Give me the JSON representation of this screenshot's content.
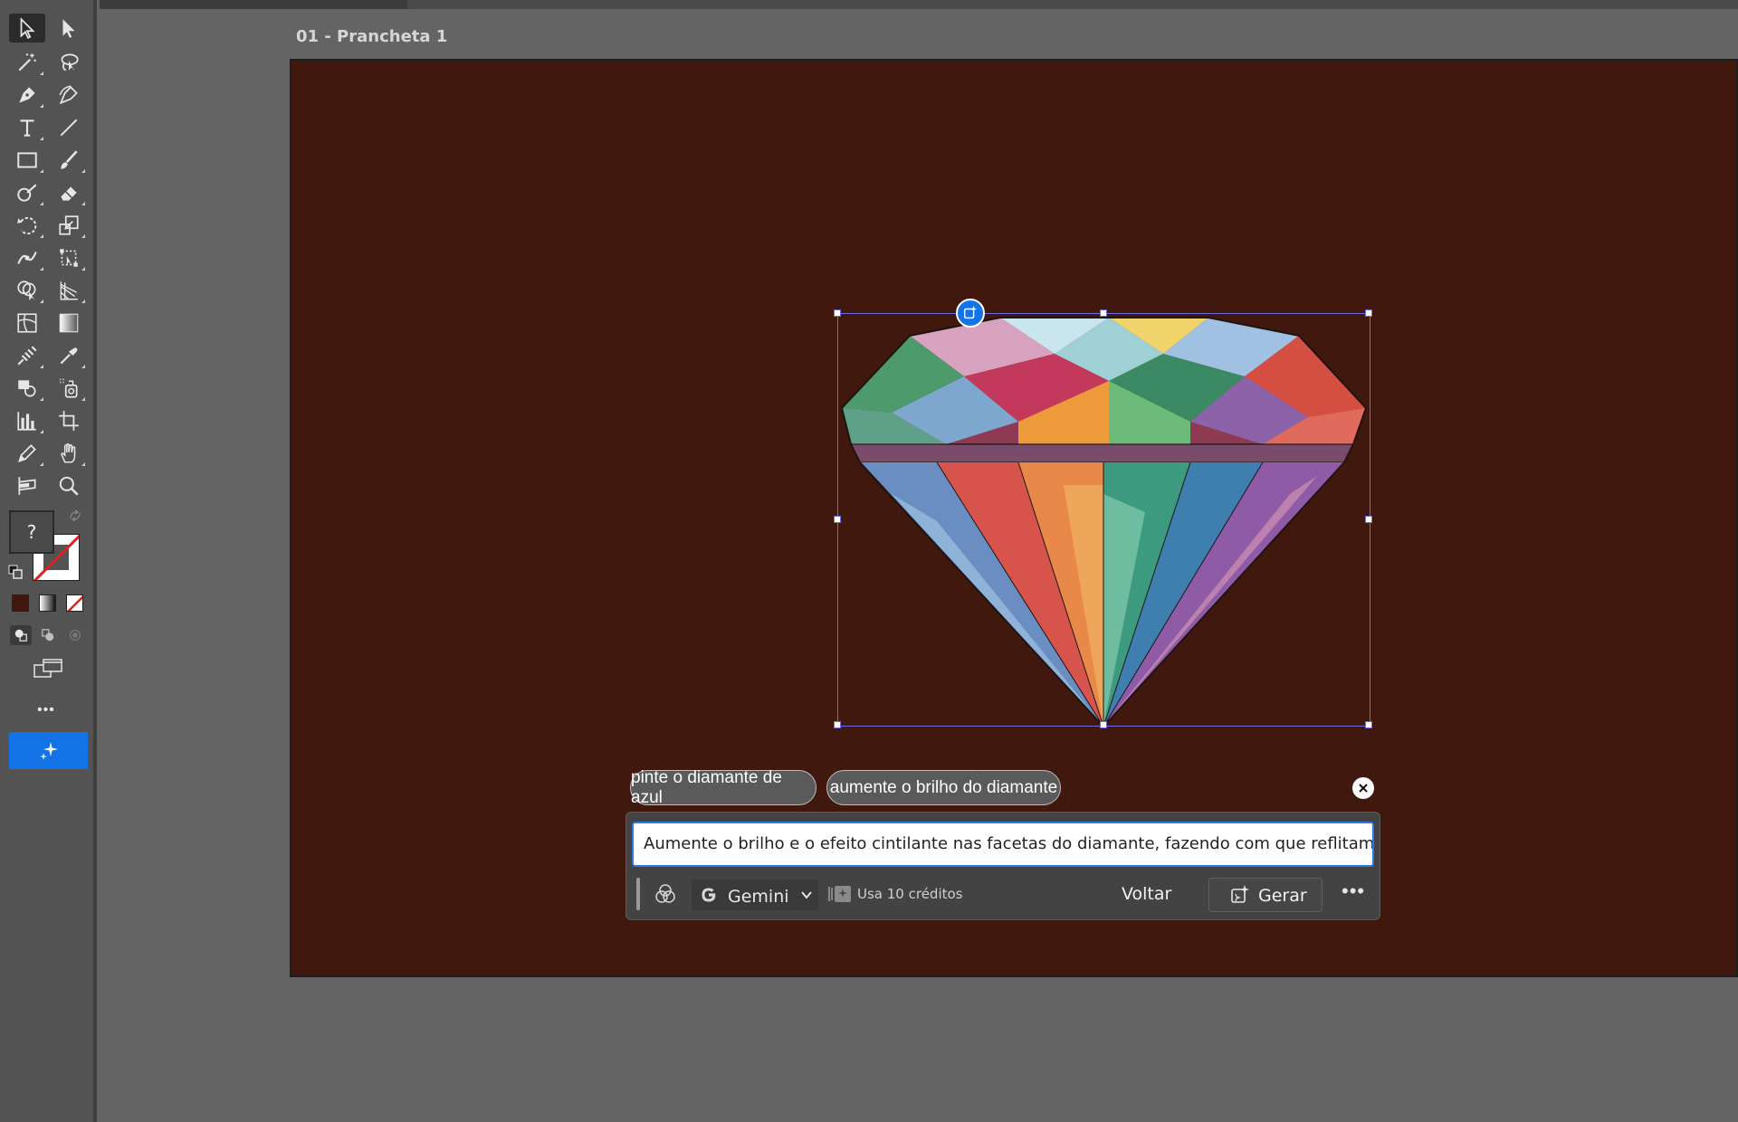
{
  "artboard": {
    "label": "01 - Prancheta 1",
    "background": "#40180e"
  },
  "toolbar": {
    "fill_unknown": "?",
    "more": "•••"
  },
  "suggestions": [
    {
      "label": "pinte o diamante de azul"
    },
    {
      "label": "aumente o brilho do diamante"
    }
  ],
  "genpanel": {
    "prompt_value": "Aumente o brilho e o efeito cintilante nas facetas do diamante, fazendo com que reflitam a luz",
    "model": "Gemini",
    "credits": "Usa 10 créditos",
    "back_label": "Voltar",
    "generate_label": "Gerar",
    "more": "•••"
  },
  "colors": {
    "accent": "#1473e6",
    "selection": "#6d6ae0"
  }
}
